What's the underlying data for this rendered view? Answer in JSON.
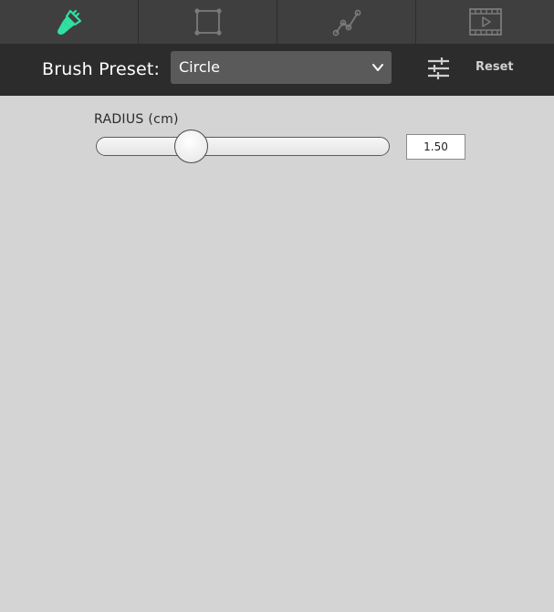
{
  "tabs": [
    {
      "icon": "paintbrush-icon",
      "active": true,
      "color": "#2fe0a0"
    },
    {
      "icon": "transform-box-icon",
      "active": false,
      "color": "#7a7a7a"
    },
    {
      "icon": "path-nodes-icon",
      "active": false,
      "color": "#7a7a7a"
    },
    {
      "icon": "video-film-icon",
      "active": false,
      "color": "#7a7a7a"
    }
  ],
  "toolbar": {
    "preset_label": "Brush Preset:",
    "preset_value": "Circle",
    "settings_icon": "sliders-icon",
    "reset_label": "Reset"
  },
  "radius": {
    "label": "RADIUS (cm)",
    "value": "1.50",
    "fraction": 0.3
  },
  "colors": {
    "accent": "#2fe0a0",
    "tabbar_bg": "#3f3f3f",
    "toolbar_bg": "#2c2c2c",
    "content_bg": "#d4d4d4"
  }
}
